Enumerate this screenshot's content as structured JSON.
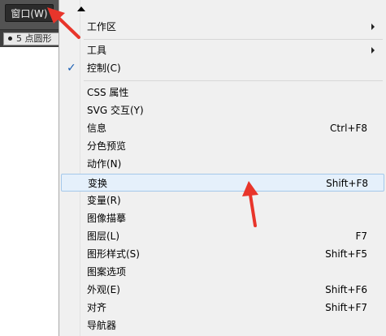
{
  "app": {
    "menu_button": "窗口(W)",
    "brush_field": "5 点圆形"
  },
  "menu": {
    "items": [
      {
        "label": "工作区",
        "shortcut": "",
        "submenu": true
      },
      {
        "label": "工具",
        "shortcut": "",
        "submenu": true
      },
      {
        "label": "控制(C)",
        "shortcut": "",
        "checked": true
      },
      {
        "label": "CSS 属性",
        "shortcut": ""
      },
      {
        "label": "SVG 交互(Y)",
        "shortcut": ""
      },
      {
        "label": "信息",
        "shortcut": "Ctrl+F8"
      },
      {
        "label": "分色预览",
        "shortcut": ""
      },
      {
        "label": "动作(N)",
        "shortcut": ""
      },
      {
        "label": "变换",
        "shortcut": "Shift+F8",
        "highlighted": true
      },
      {
        "label": "变量(R)",
        "shortcut": ""
      },
      {
        "label": "图像描摹",
        "shortcut": ""
      },
      {
        "label": "图层(L)",
        "shortcut": "F7"
      },
      {
        "label": "图形样式(S)",
        "shortcut": "Shift+F5"
      },
      {
        "label": "图案选项",
        "shortcut": ""
      },
      {
        "label": "外观(E)",
        "shortcut": "Shift+F6"
      },
      {
        "label": "对齐",
        "shortcut": "Shift+F7"
      },
      {
        "label": "导航器",
        "shortcut": ""
      }
    ],
    "check_mark": "✓"
  },
  "colors": {
    "highlight_bg": "#e5f0fb",
    "highlight_border": "#a5c8ea",
    "annotation": "#e8352b",
    "check": "#1a5fb4"
  }
}
